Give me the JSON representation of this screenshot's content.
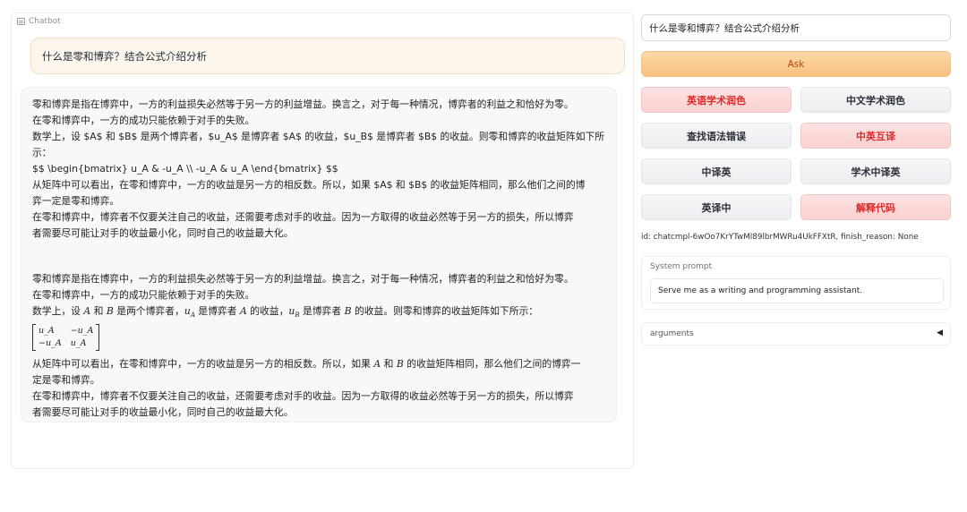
{
  "chatbot": {
    "label": "Chatbot",
    "user_message": "什么是零和博弈？结合公式介绍分析",
    "raw_reply": [
      "零和博弈是指在博弈中，一方的利益损失必然等于另一方的利益增益。换言之，对于每一种情况，博弈者的利益之和恰好为零。",
      "在零和博弈中，一方的成功只能依赖于对手的失败。",
      "数学上，设 $A$ 和 $B$ 是两个博弈者，$u_A$ 是博弈者 $A$ 的收益，$u_B$ 是博弈者 $B$ 的收益。则零和博弈的收益矩阵如下所",
      "示：",
      "$$ \\begin{bmatrix} u_A & -u_A \\\\ -u_A & u_A \\end{bmatrix} $$",
      "从矩阵中可以看出，在零和博弈中，一方的收益是另一方的相反数。所以，如果 $A$ 和 $B$ 的收益矩阵相同，那么他们之间的博",
      "弈一定是零和博弈。",
      "在零和博弈中，博弈者不仅要关注自己的收益，还需要考虑对手的收益。因为一方取得的收益必然等于另一方的损失，所以博弈",
      "者需要尽可能让对手的收益最小化，同时自己的收益最大化。"
    ],
    "rendered_reply": {
      "line1": "零和博弈是指在博弈中，一方的利益损失必然等于另一方的利益增益。换言之，对于每一种情况，博弈者的利益之和恰好为零。",
      "line2": "在零和博弈中，一方的成功只能依赖于对手的失败。",
      "line3_a": "数学上，设",
      "var_a": "A",
      "line3_b": "和",
      "var_b": "B",
      "line3_c": "是两个博弈者，",
      "var_ua": "u",
      "sub_a": "A",
      "line3_d": "是博弈者",
      "var_a2": "A",
      "line3_e": "的收益，",
      "var_ub": "u",
      "sub_b": "B",
      "line3_f": "是博弈者",
      "var_b2": "B",
      "line3_g": "的收益。则零和博弈的收益矩阵如下所示：",
      "matrix": [
        "u_A",
        "−u_A",
        "−u_A",
        "u_A"
      ],
      "line4_a": "从矩阵中可以看出，在零和博弈中，一方的收益是另一方的相反数。所以，如果",
      "var_a3": "A",
      "line4_b": "和",
      "var_b3": "B",
      "line4_c": "的收益矩阵相同，那么他们之间的博弈一",
      "line5": "定是零和博弈。",
      "line6": "在零和博弈中，博弈者不仅要关注自己的收益，还需要考虑对手的收益。因为一方取得的收益必然等于另一方的损失，所以博弈",
      "line7": "者需要尽可能让对手的收益最小化，同时自己的收益最大化。"
    }
  },
  "input": {
    "value": "什么是零和博弈？结合公式介绍分析"
  },
  "ask_button": "Ask",
  "function_buttons": [
    {
      "label": "英语学术润色",
      "style": "red"
    },
    {
      "label": "中文学术润色",
      "style": "gray"
    },
    {
      "label": "查找语法错误",
      "style": "gray"
    },
    {
      "label": "中英互译",
      "style": "red"
    },
    {
      "label": "中译英",
      "style": "gray"
    },
    {
      "label": "学术中译英",
      "style": "gray"
    },
    {
      "label": "英译中",
      "style": "gray"
    },
    {
      "label": "解释代码",
      "style": "red"
    }
  ],
  "status_line": "id: chatcmpl-6wOo7KrYTwMl89lbrMWRu4UkFFXtR, finish_reason: None",
  "system_prompt": {
    "label": "System prompt",
    "value": "Serve me as a writing and programming assistant."
  },
  "arguments": {
    "label": "arguments",
    "toggle": "◀"
  },
  "colors": {
    "accent_orange": "#f8c07e",
    "red_button_text": "#d92b2b",
    "user_bubble": "#fdf6ec"
  }
}
